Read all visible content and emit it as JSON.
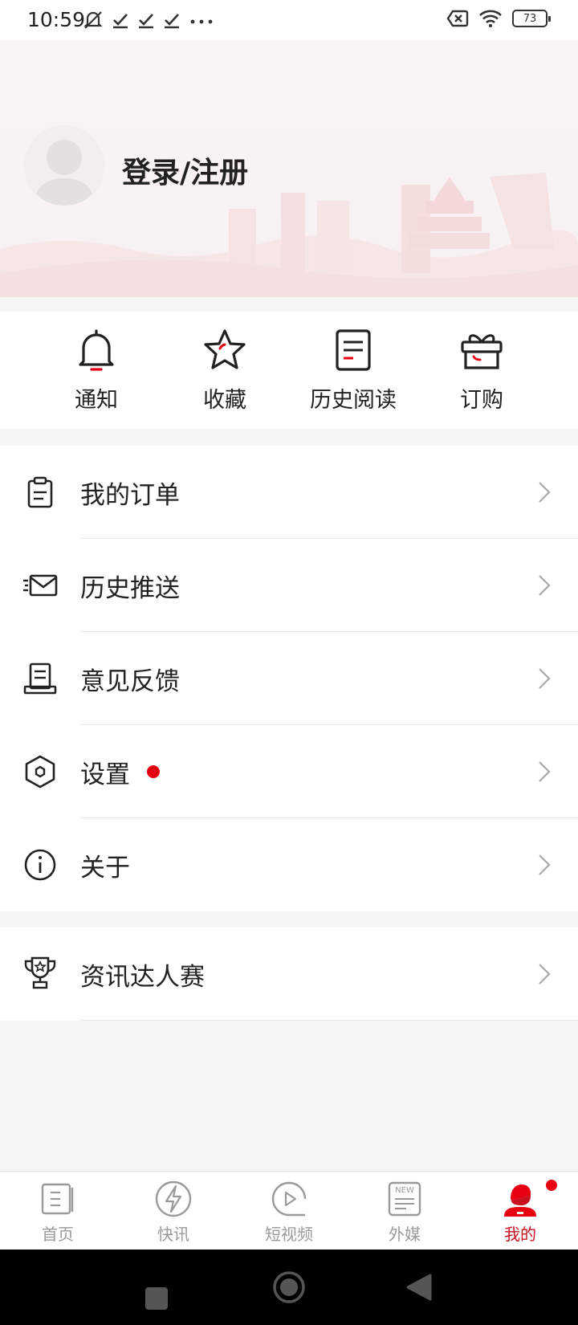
{
  "status_bar": {
    "time": "10:59",
    "battery": "73"
  },
  "profile": {
    "login_label": "登录/注册"
  },
  "quick_actions": [
    {
      "label": "通知",
      "icon": "bell-icon"
    },
    {
      "label": "收藏",
      "icon": "star-icon"
    },
    {
      "label": "历史阅读",
      "icon": "history-reading-icon"
    },
    {
      "label": "订购",
      "icon": "gift-box-icon"
    }
  ],
  "menu": [
    {
      "label": "我的订单",
      "icon": "clipboard-icon"
    },
    {
      "label": "历史推送",
      "icon": "mail-icon"
    },
    {
      "label": "意见反馈",
      "icon": "feedback-icon"
    },
    {
      "label": "设置",
      "icon": "settings-hexagon-icon",
      "has_dot": true
    },
    {
      "label": "关于",
      "icon": "info-icon"
    }
  ],
  "menu_extra": [
    {
      "label": "资讯达人赛",
      "icon": "trophy-icon"
    }
  ],
  "bottom_nav": [
    {
      "label": "首页",
      "icon": "home-news-icon"
    },
    {
      "label": "快讯",
      "icon": "lightning-icon"
    },
    {
      "label": "短视频",
      "icon": "video-play-icon"
    },
    {
      "label": "外媒",
      "icon": "new-paper-icon"
    },
    {
      "label": "我的",
      "icon": "profile-icon",
      "active": true,
      "badge": true
    }
  ],
  "colors": {
    "accent": "#e60012",
    "active_tab": "#c8101e"
  }
}
